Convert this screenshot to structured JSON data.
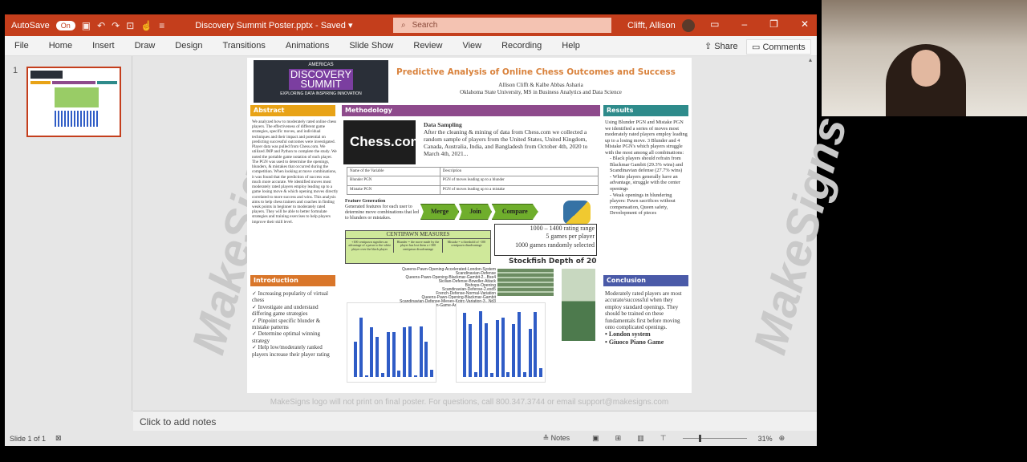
{
  "titlebar": {
    "autosave": "AutoSave",
    "toggle": "On",
    "filename": "Discovery Summit Poster.pptx",
    "saved": "Saved",
    "search_placeholder": "Search",
    "user": "Clifft, Allison"
  },
  "ribbon": {
    "tabs": [
      "File",
      "Home",
      "Insert",
      "Draw",
      "Design",
      "Transitions",
      "Animations",
      "Slide Show",
      "Review",
      "View",
      "Recording",
      "Help"
    ],
    "share": "Share",
    "comments": "Comments"
  },
  "thumbnails": {
    "slide_number": "1"
  },
  "watermark": "MakeSigns",
  "poster": {
    "logo": {
      "top": "AMERICAS",
      "main": "DISCOVERY SUMMIT",
      "sub": "EXPLORING DATA INSPIRING INNOVATION"
    },
    "title": "Predictive Analysis of Online Chess Outcomes and Success",
    "authors": "Allison Clifft & Kalbe Abbas Asharia",
    "affiliation": "Oklahoma State University, MS in Business Analytics and Data Science",
    "abstract": {
      "heading": "Abstract",
      "text": "We analyzed how to moderately rated online chess players. The effectiveness of different game strategies, specific moves, and individual techniques and their impact and potential on predicting successful outcomes were investigated. Player data was pulled from Chess.com. We utilized JMP and Python to complete the study. We noted the portable game notation of each player. The PGN was used to determine the openings, blunders, & mistakes that occurred during the competition. When looking at move combinations, it was found that the prediction of success was much more accurate. We identified moves most moderately rated players employ leading up to a game losing move & which opening moves directly correlated to more success and wins. This analysis aims to help chess trainers and coaches in finding weak points in beginner to moderately rated players. They will be able to better formulate strategies and training exercises to help players improve their skill level."
    },
    "introduction": {
      "heading": "Introduction",
      "items": [
        "Increasing popularity of virtual chess",
        "Investigate and understand differing game strategies",
        "Pinpoint specific blunder & mistake patterns",
        "Determine optimal winning strategy",
        "Help low/moderately ranked players increase their player rating"
      ]
    },
    "methodology": {
      "heading": "Methodology",
      "chess_logo": "Chess.com",
      "sampling_title": "Data Sampling",
      "sampling_text": "After the cleaning & mining of data from Chess.com we collected a random sample of players from the United States, United Kingdom, Canada, Australia, India, and Bangladesh from October 4th, 2020 to March 4th, 2021...",
      "table": {
        "headers": [
          "Name of the Variable",
          "Description"
        ],
        "rows": [
          [
            "Blunder PGN",
            "PGN of moves leading up to a blunder"
          ],
          [
            "Mistake PGN",
            "PGN of moves leading up to a mistake"
          ]
        ]
      },
      "feature_title": "Feature Generation",
      "feature_text": "Generated features for each user to determine move combinations that led to blunders or mistakes.",
      "flow": [
        "Merge",
        "Join",
        "Compare"
      ],
      "centipawn": {
        "title": "CENTIPAWN MEASURES",
        "cells": [
          "+100 centipawn signifies an advantage of a pawn to the white player over the black player",
          "Blunder = the move made by the player has lost them a +300 centipawn disadvantage",
          "Mistake = a threshold of -100 centipawn disadvantage"
        ]
      },
      "stats": [
        "1000 – 1400 rating range",
        "5 games per player",
        "1000 games randomly selected"
      ],
      "stockfish": "Stockfish Depth of 20",
      "openings": [
        "Queens-Pawn-Opening-Accelerated-London-System",
        "Scandinavian-Defense",
        "Queens-Pawn-Opening-Blackmar-Gambit-2...Bxe4",
        "Sicilian-Defense-Bowdler-Attack",
        "Bishops-Opening",
        "Scandinavian-Defense-2.exd5",
        "French-Defense-Normal-Variation",
        "Queens-Pawn-Opening-Blackmar-Gambit",
        "Scandinavian-Defense-Mieses-Kotrc-Variation-3...Nd3",
        "Italian-Game-Anti-Fried-Liver-Defense"
      ],
      "chart_left": [
        55,
        92,
        3,
        78,
        63,
        6,
        70,
        70,
        10,
        77,
        79,
        3,
        79,
        55,
        11
      ],
      "chart_right": [
        100,
        82,
        7,
        102,
        84,
        6,
        89,
        92,
        7,
        83,
        101,
        7,
        75,
        101,
        14
      ],
      "bar_color": "#2f5cc6"
    },
    "results": {
      "heading": "Results",
      "text": "Using Blunder PGN and Mistake PGN we identified a series of moves most moderately rated players employ leading up to a losing move. 3 Blunder and 4 Mistake PGN's which players struggle with the most among all combinations:",
      "items": [
        "Black players should refrain from Blackmar Gambit (29.3% wins) and Scandinavian defense (27.7% wins)",
        "White players generally have an advantage, struggle with the center openings",
        "Weak openings in blundering players: Pawn sacrifices without compensation, Queen safety, Development of pieces"
      ]
    },
    "conclusion": {
      "heading": "Conclusion",
      "text": "Moderately rated players are most accurate/successful when they employ standard openings. They should be trained on these fundamentals first before moving onto complicated openings.",
      "items": [
        "London system",
        "Giuoco Piano Game"
      ]
    },
    "colors": {
      "abstract": "#e8a317",
      "methodology": "#8e4a8c",
      "results": "#2e8b8b",
      "introduction": "#d9762a",
      "conclusion": "#4a5aa8",
      "title": "#d9823c"
    }
  },
  "footer_note": "MakeSigns logo will not print on final poster. For questions, call 800.347.3744 or email support@makesigns.com",
  "notes_placeholder": "Click to add notes",
  "statusbar": {
    "slide": "Slide 1 of 1",
    "notes": "Notes",
    "zoom": "31%"
  },
  "accent": "#c43e1c"
}
